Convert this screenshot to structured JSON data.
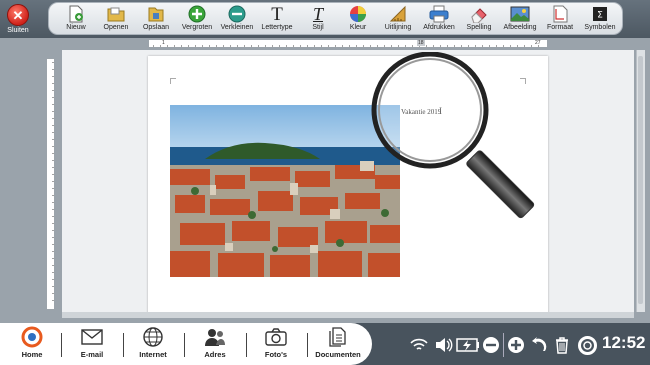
{
  "app": {
    "close_label": "Sluiten"
  },
  "toolbar": {
    "items": [
      {
        "label": "Nieuw",
        "icon": "new-document-icon"
      },
      {
        "label": "Openen",
        "icon": "folder-icon"
      },
      {
        "label": "Opslaan",
        "icon": "save-icon"
      },
      {
        "label": "Vergroten",
        "icon": "zoom-in-icon"
      },
      {
        "label": "Verkleinen",
        "icon": "zoom-out-icon"
      },
      {
        "label": "Lettertype",
        "icon": "font-icon"
      },
      {
        "label": "Stijl",
        "icon": "italic-icon"
      },
      {
        "label": "Kleur",
        "icon": "color-icon"
      },
      {
        "label": "Uitlijning",
        "icon": "alignment-icon"
      },
      {
        "label": "Afdrukken",
        "icon": "printer-icon"
      },
      {
        "label": "Spelling",
        "icon": "eraser-icon"
      },
      {
        "label": "Afbeelding",
        "icon": "image-icon"
      },
      {
        "label": "Formaat",
        "icon": "page-format-icon"
      },
      {
        "label": "Symbolen",
        "icon": "symbols-icon"
      }
    ]
  },
  "ruler": {
    "start": "1",
    "end": "27",
    "marker": "18"
  },
  "document": {
    "text": "Vakantie 2019",
    "cursor": "I"
  },
  "bottom_nav": {
    "items": [
      {
        "label": "Home",
        "icon": "home-icon"
      },
      {
        "label": "E-mail",
        "icon": "email-icon"
      },
      {
        "label": "Internet",
        "icon": "globe-icon"
      },
      {
        "label": "Adres",
        "icon": "contacts-icon"
      },
      {
        "label": "Foto's",
        "icon": "camera-icon"
      },
      {
        "label": "Documenten",
        "icon": "documents-icon"
      }
    ]
  },
  "tray": {
    "time": "12:52"
  }
}
